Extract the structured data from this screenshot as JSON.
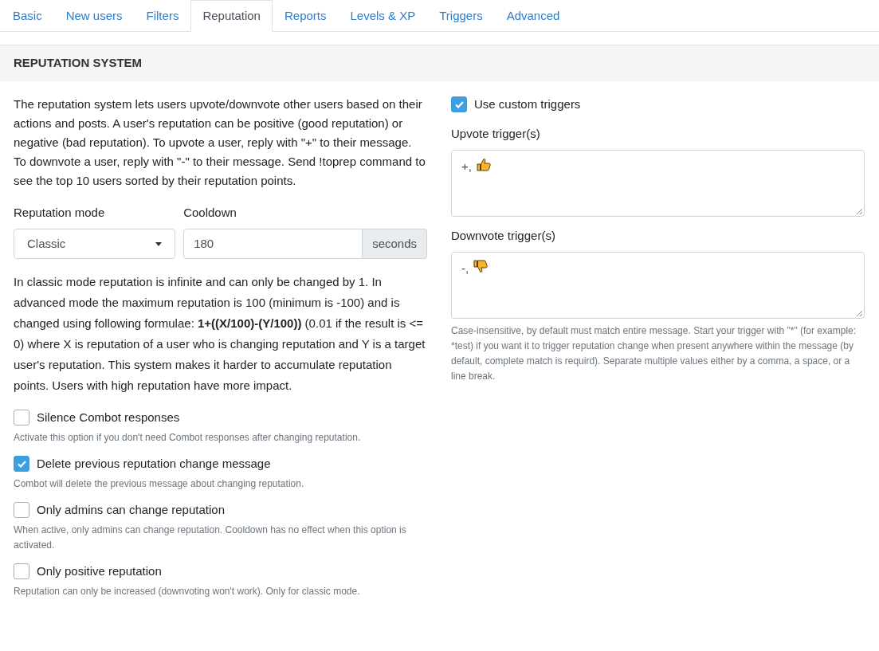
{
  "tabs": [
    {
      "label": "Basic",
      "selected": false
    },
    {
      "label": "New users",
      "selected": false
    },
    {
      "label": "Filters",
      "selected": false
    },
    {
      "label": "Reputation",
      "selected": true
    },
    {
      "label": "Reports",
      "selected": false
    },
    {
      "label": "Levels & XP",
      "selected": false
    },
    {
      "label": "Triggers",
      "selected": false
    },
    {
      "label": "Advanced",
      "selected": false
    }
  ],
  "section_title": "REPUTATION SYSTEM",
  "intro": "The reputation system lets users upvote/downvote other users based on their actions and posts. A user's reputation can be positive (good reputation) or negative (bad reputation). To upvote a user, reply with \"+\" to their message. To downvote a user, reply with \"-\" to their message. Send !toprep command to see the top 10 users sorted by their reputation points.",
  "reputation_mode": {
    "label": "Reputation mode",
    "value": "Classic"
  },
  "cooldown": {
    "label": "Cooldown",
    "value": "180",
    "unit": "seconds"
  },
  "mode_help": "In classic mode reputation is infinite and can only be changed by 1. In advanced mode the maximum reputation is 100 (minimum is -100) and is changed using following formulae: **1+((X/100)-(Y/100))** (0.01 if the result is <= 0) where X is reputation of a user who is changing reputation and Y is a target user's reputation. This system makes it harder to accumulate reputation points. Users with high reputation have more impact.",
  "options": [
    {
      "label": "Silence Combot responses",
      "checked": false,
      "help": "Activate this option if you don't need Combot responses after changing reputation."
    },
    {
      "label": "Delete previous reputation change message",
      "checked": true,
      "help": "Combot will delete the previous message about changing reputation."
    },
    {
      "label": "Only admins can change reputation",
      "checked": false,
      "help": "When active, only admins can change reputation. Cooldown has no effect when this option is activated."
    },
    {
      "label": "Only positive reputation",
      "checked": false,
      "help": "Reputation can only be increased (downvoting won't work). Only for classic mode."
    }
  ],
  "custom_triggers": {
    "label": "Use custom triggers",
    "checked": true
  },
  "triggers": [
    {
      "kind": "upvote",
      "label": "Upvote trigger(s)",
      "value": "+,"
    },
    {
      "kind": "downvote",
      "label": "Downvote trigger(s)",
      "value": "-,"
    }
  ],
  "triggers_help": "Case-insensitive, by default must match entire message. Start your trigger with \"*\" (for example: *test) if you want it to trigger reputation change when present anywhere within the message (by default, complete match is requird). Separate multiple values either by a comma, a space, or a line break."
}
